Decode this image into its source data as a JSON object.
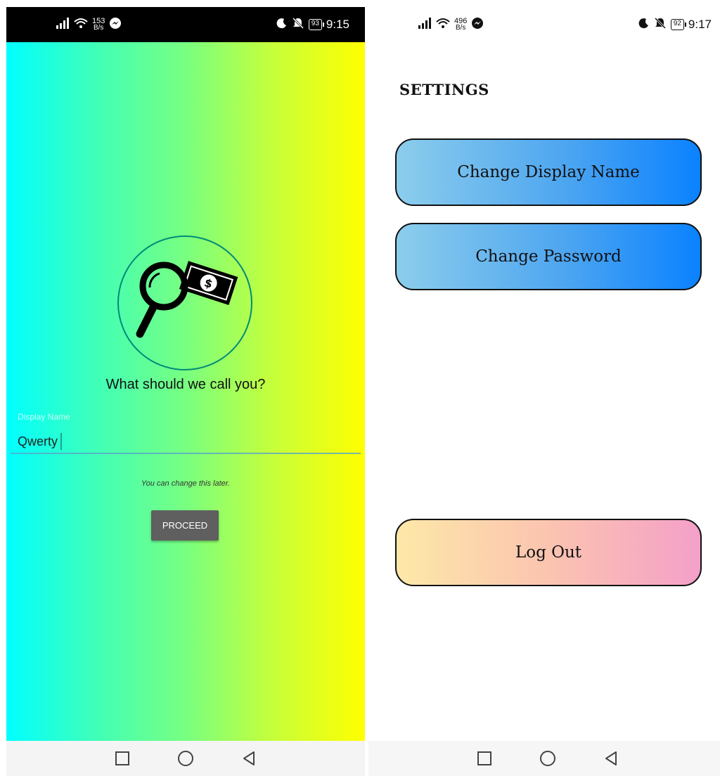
{
  "left_screen": {
    "status": {
      "speed_value": "153",
      "speed_unit": "B/s",
      "battery": "93",
      "time": "9:15"
    },
    "question": "What should we call you?",
    "field_label": "Display Name",
    "input_value": "Qwerty",
    "hint": "You can change this later.",
    "proceed_label": "PROCEED"
  },
  "right_screen": {
    "status": {
      "speed_value": "496",
      "speed_unit": "B/s",
      "battery": "92",
      "time": "9:17"
    },
    "title": "SETTINGS",
    "change_display_name_label": "Change Display Name",
    "change_password_label": "Change Password",
    "logout_label": "Log Out"
  },
  "colors": {
    "left_gradient_start": "#00ffff",
    "left_gradient_end": "#ffff00",
    "blue_button_start": "#8ccdec",
    "blue_button_end": "#0a82ff",
    "pink_button_start": "#fde8a8",
    "pink_button_end": "#f4a0c8",
    "proceed_bg": "#5f5f5f",
    "logo_ring": "#00897b"
  },
  "icons": {
    "logo": "magnifier-over-dollar-bill",
    "status": [
      "signal-icon",
      "wifi-icon",
      "messenger-icon",
      "moon-icon",
      "bell-off-icon",
      "battery-icon"
    ],
    "nav": [
      "square-recent-icon",
      "circle-home-icon",
      "triangle-back-icon"
    ]
  }
}
